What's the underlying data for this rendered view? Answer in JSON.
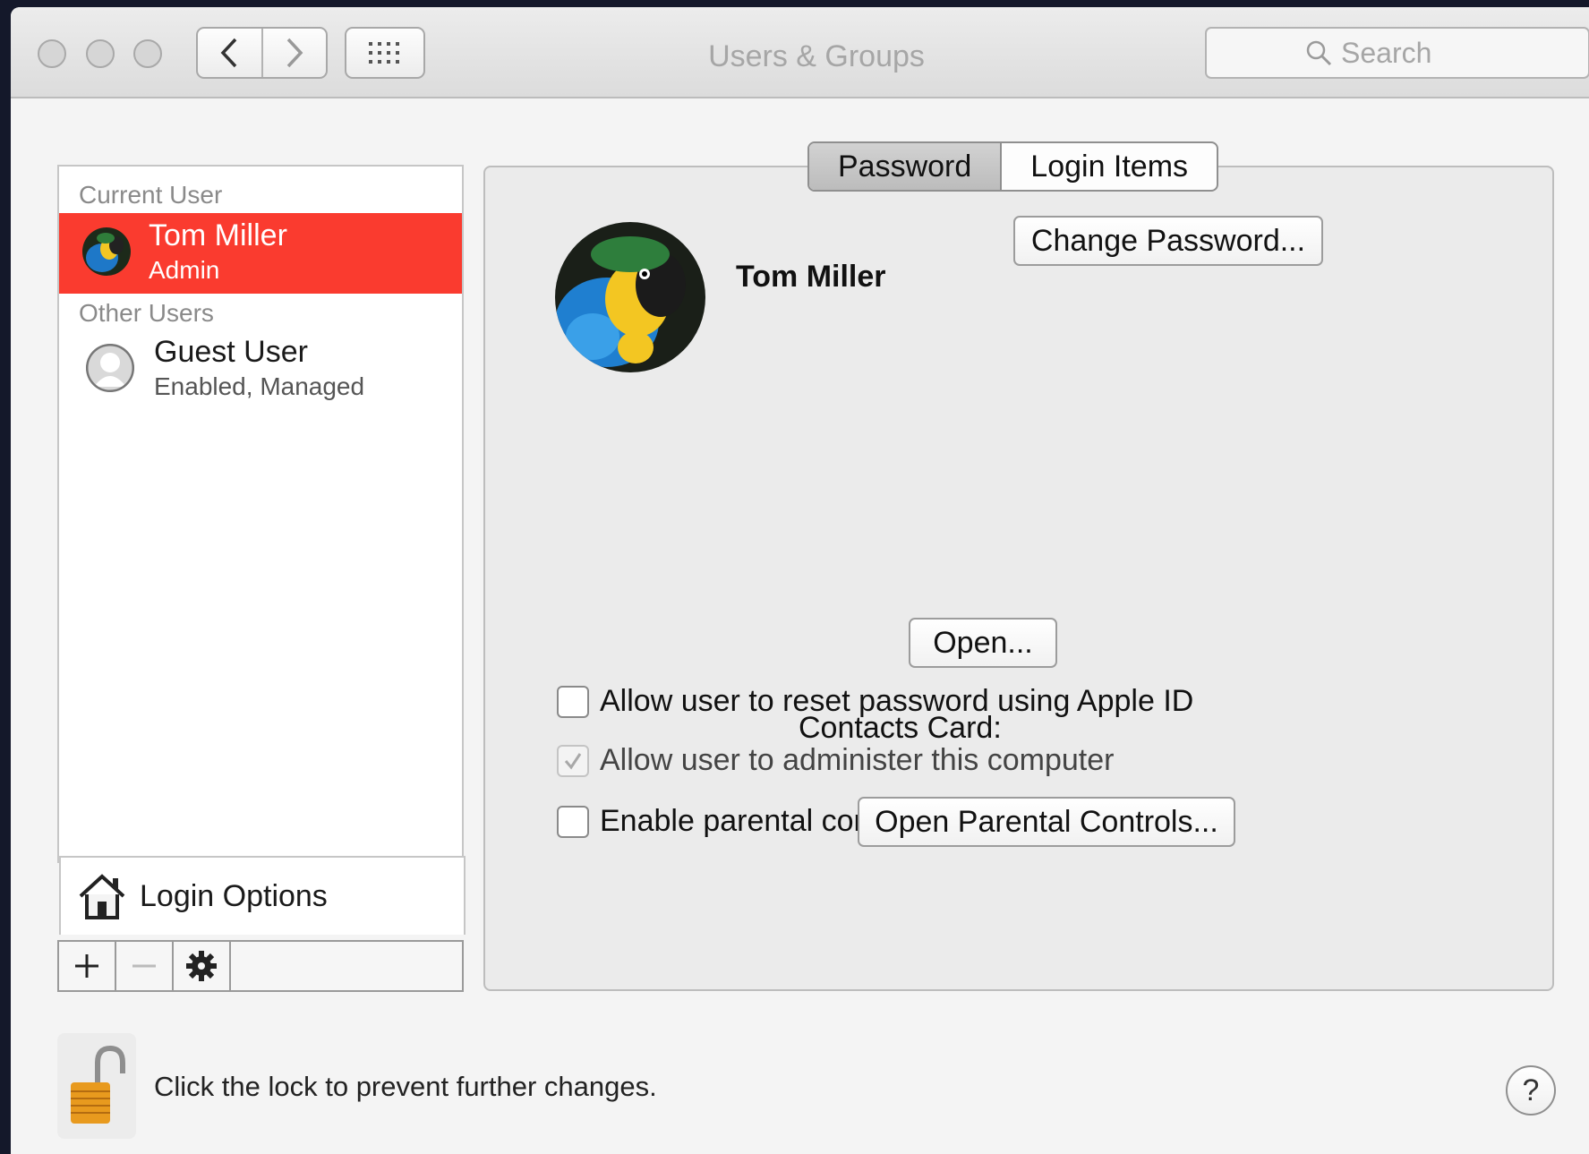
{
  "window": {
    "title": "Users & Groups"
  },
  "toolbar": {
    "back_icon": "chevron-left-icon",
    "forward_icon": "chevron-right-icon",
    "grid_icon": "grid-icon",
    "search": {
      "placeholder": "Search",
      "icon": "search-icon"
    }
  },
  "sidebar": {
    "current_user_heading": "Current User",
    "current_user": {
      "name": "Tom Miller",
      "role": "Admin",
      "avatar": "parrot-avatar"
    },
    "other_users_heading": "Other Users",
    "other_users": [
      {
        "name": "Guest User",
        "role": "Enabled, Managed",
        "avatar": "guest-avatar"
      }
    ],
    "login_options_label": "Login Options",
    "login_options_icon": "house-icon",
    "tools": [
      "add-icon",
      "remove-icon",
      "gear-icon"
    ]
  },
  "tabs": [
    {
      "label": "Password",
      "active": true
    },
    {
      "label": "Login Items",
      "active": false
    }
  ],
  "main": {
    "user_name": "Tom Miller",
    "change_password_label": "Change Password...",
    "contacts_card_label": "Contacts Card:",
    "open_button_label": "Open...",
    "checkboxes": [
      {
        "label": "Allow user to reset password using Apple ID",
        "checked": false,
        "enabled": true
      },
      {
        "label": "Allow user to administer this computer",
        "checked": true,
        "enabled": false
      },
      {
        "label": "Enable parental controls",
        "checked": false,
        "enabled": true
      }
    ],
    "open_parental_controls_label": "Open Parental Controls..."
  },
  "footer": {
    "lock_text": "Click the lock to prevent further changes.",
    "lock_icon": "unlocked-padlock-icon",
    "help_label": "?"
  },
  "colors": {
    "selection": "#fa3b2f",
    "window_bg": "#f4f4f4",
    "desktop": "#14182a"
  }
}
